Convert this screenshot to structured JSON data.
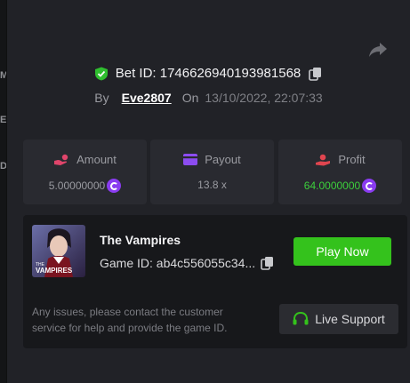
{
  "left_strip": {
    "chars": [
      "M",
      "E",
      "D"
    ]
  },
  "header": {
    "bet_id_label": "Bet ID: 1746626940193981568",
    "by_label": "By",
    "username": "Eve2807",
    "on_label": "On",
    "datetime": "13/10/2022, 22:07:33"
  },
  "stats": {
    "amount": {
      "label": "Amount",
      "value": "5.00000000"
    },
    "payout": {
      "label": "Payout",
      "value": "13.8 x"
    },
    "profit": {
      "label": "Profit",
      "value": "64.0000000"
    }
  },
  "game": {
    "title": "The Vampires",
    "id_text": "Game ID: ab4c556055c34...",
    "play_button": "Play Now",
    "thumb_caption_small": "THE",
    "thumb_caption_big": "VAMPIRES"
  },
  "support": {
    "help_text": "Any issues, please contact the customer service for help and provide the game ID.",
    "button_label": "Live Support"
  },
  "colors": {
    "accent_green": "#34c21c",
    "profit_green": "#3ccf3c",
    "coin_purple": "#8a3cf0",
    "amount_icon_pink": "#e0456b",
    "payout_icon_purple": "#8c4cf0",
    "profit_icon_red": "#e0454f"
  },
  "icons": {
    "share": "share-icon",
    "shield": "shield-check-icon",
    "copy": "copy-icon",
    "amount": "hand-coin-icon",
    "payout": "wallet-icon",
    "profit": "profit-hand-icon",
    "coin": "currency-coin-icon",
    "support": "headset-icon"
  }
}
